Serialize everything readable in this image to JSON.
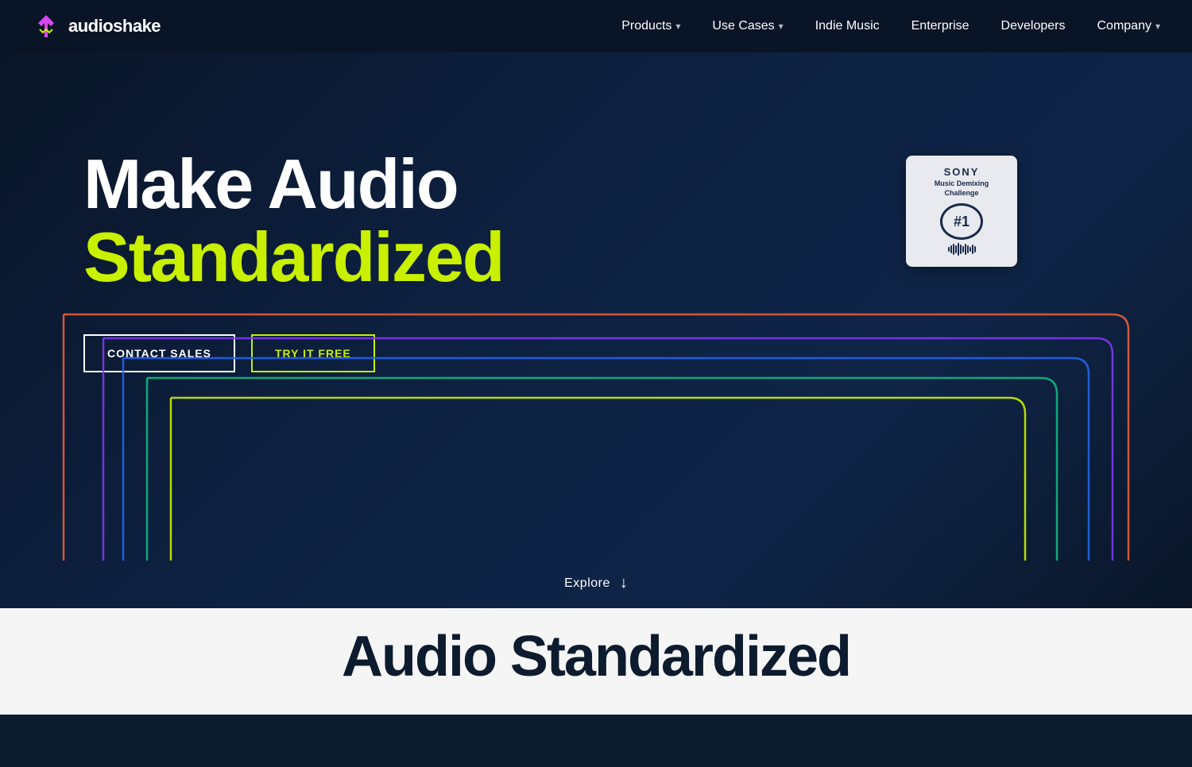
{
  "brand": {
    "name": "audioshake",
    "logo_alt": "AudioShake logo"
  },
  "nav": {
    "links": [
      {
        "id": "products",
        "label": "Products",
        "has_dropdown": true
      },
      {
        "id": "use-cases",
        "label": "Use Cases",
        "has_dropdown": true
      },
      {
        "id": "indie-music",
        "label": "Indie Music",
        "has_dropdown": false
      },
      {
        "id": "enterprise",
        "label": "Enterprise",
        "has_dropdown": false
      },
      {
        "id": "developers",
        "label": "Developers",
        "has_dropdown": false
      },
      {
        "id": "company",
        "label": "Company",
        "has_dropdown": true
      }
    ]
  },
  "hero": {
    "headline_part1": "Make Audio ",
    "headline_part2": "Standardized",
    "cta_contact": "CONTACT SALES",
    "cta_try": "TRY IT FREE"
  },
  "sony_badge": {
    "title": "SONY",
    "subtitle": "Music Demixing",
    "subtitle2": "Challenge",
    "rank": "#1"
  },
  "explore": {
    "label": "Explore"
  },
  "bottom": {
    "title": "Audio Standardized"
  },
  "colors": {
    "accent": "#c8f000",
    "dark_bg": "#0d1b2e",
    "light_bg": "#f5f5f5"
  }
}
